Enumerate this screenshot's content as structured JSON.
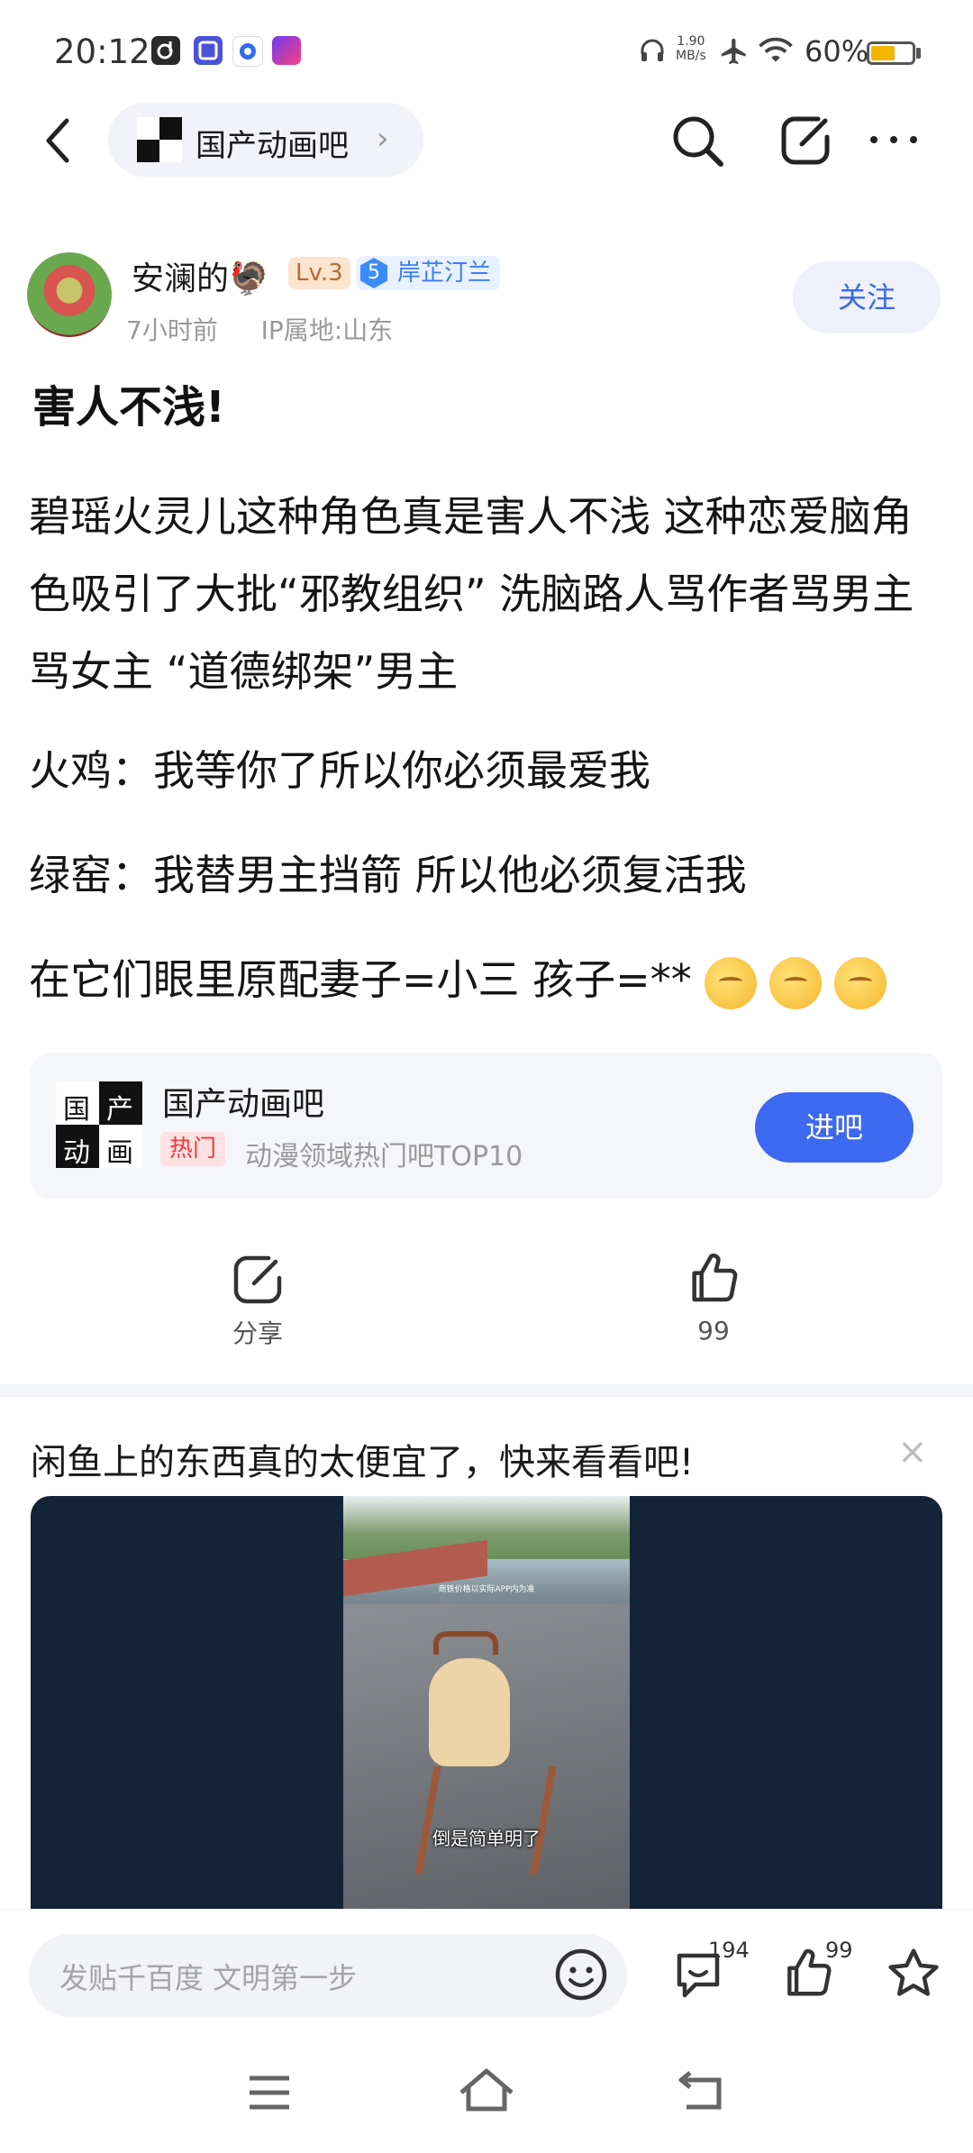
{
  "status_bar": {
    "time": "20:12",
    "net_speed_value": "1.90",
    "net_speed_unit": "MB/s",
    "battery_pct": "60%",
    "battery_level": 0.6
  },
  "nav": {
    "forum_name": "国产动画吧",
    "chevron": "›"
  },
  "author": {
    "name": "安澜的🦃",
    "level": "Lv.3",
    "honor_num": "5",
    "honor_label": "岸芷汀兰",
    "time_ago": "7小时前",
    "ip": "IP属地:山东",
    "follow_label": "关注"
  },
  "post": {
    "title": "害人不浅!",
    "paragraphs": [
      "碧瑶火灵儿这种角色真是害人不浅 这种恋爱脑角色吸引了大批“邪教组织” 洗脑路人骂作者骂男主骂女主 “道德绑架”男主",
      "火鸡：我等你了所以你必须最爱我",
      "绿窑：我替男主挡箭 所以他必须复活我",
      "在它们眼里原配妻子=小三 孩子=**"
    ]
  },
  "forum_card": {
    "name": "国产动画吧",
    "hot_badge": "热门",
    "description": "动漫领域热门吧TOP10",
    "enter_label": "进吧",
    "logo_chars": [
      "国",
      "产",
      "动",
      "画"
    ]
  },
  "actions": {
    "share_label": "分享",
    "like_count": "99"
  },
  "ad": {
    "title": "闲鱼上的东西真的太便宜了，快来看看吧!",
    "close": "×",
    "video_caption": "倒是简单明了",
    "video_sub": "商铁价格以实际APP内为准"
  },
  "bottom_bar": {
    "input_placeholder": "发贴千百度 文明第一步",
    "comment_count": "194",
    "like_count": "99"
  },
  "colors": {
    "accent": "#3d68f0",
    "hot": "#ee3b3b",
    "battery": "#f4b400"
  }
}
